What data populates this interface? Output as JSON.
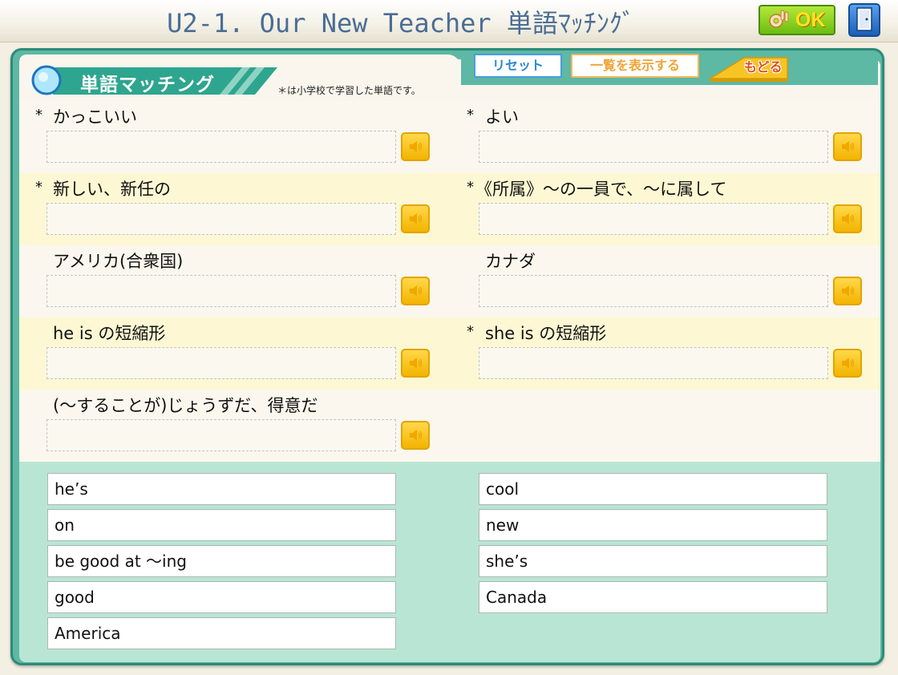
{
  "header": {
    "title": "U2-1.  Our New Teacher   単語ﾏｯﾁﾝｸﾞ",
    "ok_label": "OK"
  },
  "panel": {
    "tab_title": "単語マッチング",
    "note": "＊は小学校で学習した単語です。",
    "reset_label": "リセット",
    "list_label": "一覧を表示する",
    "back_label": "もどる"
  },
  "questions": [
    {
      "marker": "*",
      "label": "かっこいい"
    },
    {
      "marker": "*",
      "label": "よい"
    },
    {
      "marker": "*",
      "label": "新しい、新任の"
    },
    {
      "marker": "*",
      "label": "《所属》～の一員で、～に属して"
    },
    {
      "marker": "",
      "label": "アメリカ(合衆国)"
    },
    {
      "marker": "",
      "label": "カナダ"
    },
    {
      "marker": "",
      "label": "he is の短縮形"
    },
    {
      "marker": "*",
      "label": "she is の短縮形"
    },
    {
      "marker": "",
      "label": "(～することが)じょうずだ、得意だ"
    }
  ],
  "word_bank": {
    "left": [
      "he’s",
      "on",
      "be good at ～ing",
      "good",
      "America"
    ],
    "right": [
      "cool",
      "new",
      "she’s",
      "Canada"
    ]
  }
}
